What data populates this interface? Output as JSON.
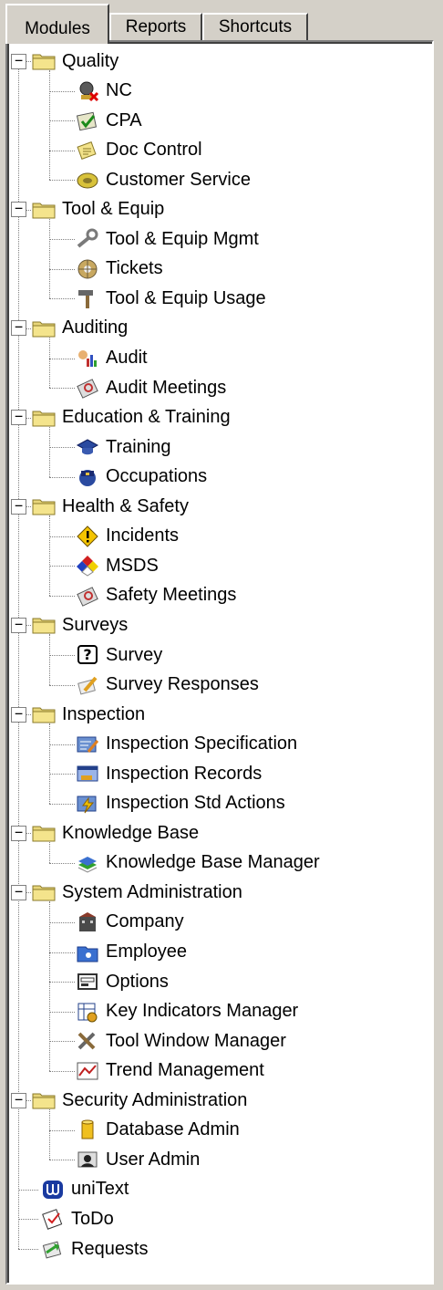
{
  "tabs": [
    {
      "label": "Modules",
      "active": true
    },
    {
      "label": "Reports",
      "active": false
    },
    {
      "label": "Shortcuts",
      "active": false
    }
  ],
  "tree": [
    {
      "label": "Quality",
      "expand": "−",
      "children": [
        {
          "label": "NC",
          "icon": "nc-icon"
        },
        {
          "label": "CPA",
          "icon": "cpa-icon"
        },
        {
          "label": "Doc Control",
          "icon": "doc-control-icon"
        },
        {
          "label": "Customer Service",
          "icon": "customer-service-icon"
        }
      ]
    },
    {
      "label": "Tool & Equip",
      "expand": "−",
      "children": [
        {
          "label": "Tool & Equip Mgmt",
          "icon": "wrench-icon"
        },
        {
          "label": "Tickets",
          "icon": "tickets-icon"
        },
        {
          "label": "Tool & Equip Usage",
          "icon": "hammer-icon"
        }
      ]
    },
    {
      "label": "Auditing",
      "expand": "−",
      "children": [
        {
          "label": "Audit",
          "icon": "audit-icon"
        },
        {
          "label": "Audit Meetings",
          "icon": "meetings-icon"
        }
      ]
    },
    {
      "label": "Education & Training",
      "expand": "−",
      "children": [
        {
          "label": "Training",
          "icon": "graduation-cap-icon"
        },
        {
          "label": "Occupations",
          "icon": "occupations-icon"
        }
      ]
    },
    {
      "label": "Health & Safety",
      "expand": "−",
      "children": [
        {
          "label": "Incidents",
          "icon": "warning-icon"
        },
        {
          "label": "MSDS",
          "icon": "msds-diamond-icon"
        },
        {
          "label": "Safety Meetings",
          "icon": "meetings-icon"
        }
      ]
    },
    {
      "label": "Surveys",
      "expand": "−",
      "children": [
        {
          "label": "Survey",
          "icon": "question-icon"
        },
        {
          "label": "Survey Responses",
          "icon": "pencil-icon"
        }
      ]
    },
    {
      "label": "Inspection",
      "expand": "−",
      "children": [
        {
          "label": "Inspection Specification",
          "icon": "inspection-spec-icon"
        },
        {
          "label": "Inspection Records",
          "icon": "inspection-records-icon"
        },
        {
          "label": "Inspection Std Actions",
          "icon": "inspection-actions-icon"
        }
      ]
    },
    {
      "label": "Knowledge Base",
      "expand": "−",
      "children": [
        {
          "label": "Knowledge Base Manager",
          "icon": "books-icon"
        }
      ]
    },
    {
      "label": "System Administration",
      "expand": "−",
      "children": [
        {
          "label": "Company",
          "icon": "company-icon"
        },
        {
          "label": "Employee",
          "icon": "employee-folder-icon"
        },
        {
          "label": "Options",
          "icon": "options-icon"
        },
        {
          "label": "Key Indicators Manager",
          "icon": "key-indicators-icon"
        },
        {
          "label": "Tool Window Manager",
          "icon": "tools-icon"
        },
        {
          "label": "Trend Management",
          "icon": "trend-icon"
        }
      ]
    },
    {
      "label": "Security Administration",
      "expand": "−",
      "children": [
        {
          "label": "Database Admin",
          "icon": "database-icon"
        },
        {
          "label": "User Admin",
          "icon": "user-admin-icon"
        }
      ]
    }
  ],
  "root_items": [
    {
      "label": "uniText",
      "icon": "unitext-icon"
    },
    {
      "label": "ToDo",
      "icon": "todo-icon"
    },
    {
      "label": "Requests",
      "icon": "requests-icon"
    }
  ]
}
